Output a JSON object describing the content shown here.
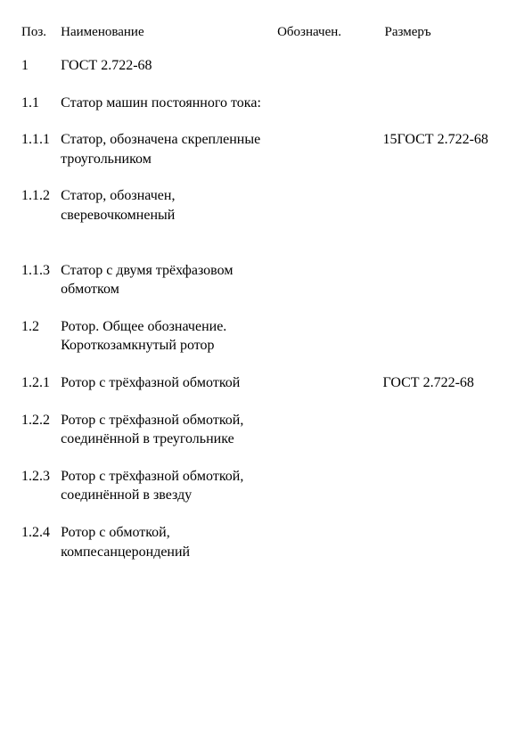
{
  "headers": {
    "pos": "Поз.",
    "name": "Наименование",
    "obz": "Обозначен.",
    "raz": "Размеръ"
  },
  "rows": [
    {
      "pos": "1",
      "name": "ГОСТ 2.722-68",
      "obz": "",
      "raz": ""
    },
    {
      "pos": "1.1",
      "name": "Статор машин постоянного тока:",
      "obz": "",
      "raz": ""
    },
    {
      "pos": "1.1.1",
      "name": "Статор, обозначена скрепленные троугольником",
      "obz": "",
      "raz": "15ГОСТ 2.722-68"
    },
    {
      "pos": "1.1.2",
      "name": "Статор, обозначен, сверевочкомненый",
      "obz": "",
      "raz": ""
    },
    {
      "pos": "1.1.3",
      "name": "Статор с двумя трёхфазовом обмотком",
      "obz": "",
      "raz": ""
    },
    {
      "pos": "1.2",
      "name": "Ротор. Общее обозначение. Короткозамкнутый ротор",
      "obz": "",
      "raz": ""
    },
    {
      "pos": "1.2.1",
      "name": "Ротор с трёхфазной обмоткой",
      "obz": "",
      "raz": "ГОСТ 2.722-68"
    },
    {
      "pos": "1.2.2",
      "name": "Ротор с трёхфазной обмоткой, соединённой в треугольнике",
      "obz": "",
      "raz": ""
    },
    {
      "pos": "1.2.3",
      "name": "Ротор с трёхфазной обмоткой, соединённой в звезду",
      "obz": "",
      "raz": ""
    },
    {
      "pos": "1.2.4",
      "name": "Ротор с обмоткой, компесанцерондений",
      "obz": "",
      "raz": ""
    }
  ]
}
